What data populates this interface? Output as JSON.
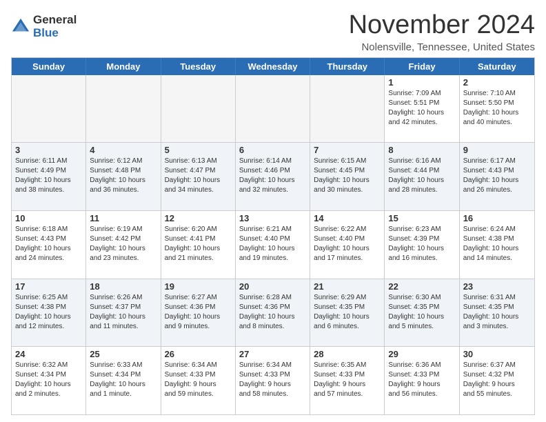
{
  "logo": {
    "general": "General",
    "blue": "Blue"
  },
  "title": "November 2024",
  "location": "Nolensville, Tennessee, United States",
  "weekdays": [
    "Sunday",
    "Monday",
    "Tuesday",
    "Wednesday",
    "Thursday",
    "Friday",
    "Saturday"
  ],
  "weeks": [
    [
      {
        "day": "",
        "info": "",
        "empty": true
      },
      {
        "day": "",
        "info": "",
        "empty": true
      },
      {
        "day": "",
        "info": "",
        "empty": true
      },
      {
        "day": "",
        "info": "",
        "empty": true
      },
      {
        "day": "",
        "info": "",
        "empty": true
      },
      {
        "day": "1",
        "info": "Sunrise: 7:09 AM\nSunset: 5:51 PM\nDaylight: 10 hours\nand 42 minutes.",
        "empty": false
      },
      {
        "day": "2",
        "info": "Sunrise: 7:10 AM\nSunset: 5:50 PM\nDaylight: 10 hours\nand 40 minutes.",
        "empty": false
      }
    ],
    [
      {
        "day": "3",
        "info": "Sunrise: 6:11 AM\nSunset: 4:49 PM\nDaylight: 10 hours\nand 38 minutes.",
        "empty": false
      },
      {
        "day": "4",
        "info": "Sunrise: 6:12 AM\nSunset: 4:48 PM\nDaylight: 10 hours\nand 36 minutes.",
        "empty": false
      },
      {
        "day": "5",
        "info": "Sunrise: 6:13 AM\nSunset: 4:47 PM\nDaylight: 10 hours\nand 34 minutes.",
        "empty": false
      },
      {
        "day": "6",
        "info": "Sunrise: 6:14 AM\nSunset: 4:46 PM\nDaylight: 10 hours\nand 32 minutes.",
        "empty": false
      },
      {
        "day": "7",
        "info": "Sunrise: 6:15 AM\nSunset: 4:45 PM\nDaylight: 10 hours\nand 30 minutes.",
        "empty": false
      },
      {
        "day": "8",
        "info": "Sunrise: 6:16 AM\nSunset: 4:44 PM\nDaylight: 10 hours\nand 28 minutes.",
        "empty": false
      },
      {
        "day": "9",
        "info": "Sunrise: 6:17 AM\nSunset: 4:43 PM\nDaylight: 10 hours\nand 26 minutes.",
        "empty": false
      }
    ],
    [
      {
        "day": "10",
        "info": "Sunrise: 6:18 AM\nSunset: 4:43 PM\nDaylight: 10 hours\nand 24 minutes.",
        "empty": false
      },
      {
        "day": "11",
        "info": "Sunrise: 6:19 AM\nSunset: 4:42 PM\nDaylight: 10 hours\nand 23 minutes.",
        "empty": false
      },
      {
        "day": "12",
        "info": "Sunrise: 6:20 AM\nSunset: 4:41 PM\nDaylight: 10 hours\nand 21 minutes.",
        "empty": false
      },
      {
        "day": "13",
        "info": "Sunrise: 6:21 AM\nSunset: 4:40 PM\nDaylight: 10 hours\nand 19 minutes.",
        "empty": false
      },
      {
        "day": "14",
        "info": "Sunrise: 6:22 AM\nSunset: 4:40 PM\nDaylight: 10 hours\nand 17 minutes.",
        "empty": false
      },
      {
        "day": "15",
        "info": "Sunrise: 6:23 AM\nSunset: 4:39 PM\nDaylight: 10 hours\nand 16 minutes.",
        "empty": false
      },
      {
        "day": "16",
        "info": "Sunrise: 6:24 AM\nSunset: 4:38 PM\nDaylight: 10 hours\nand 14 minutes.",
        "empty": false
      }
    ],
    [
      {
        "day": "17",
        "info": "Sunrise: 6:25 AM\nSunset: 4:38 PM\nDaylight: 10 hours\nand 12 minutes.",
        "empty": false
      },
      {
        "day": "18",
        "info": "Sunrise: 6:26 AM\nSunset: 4:37 PM\nDaylight: 10 hours\nand 11 minutes.",
        "empty": false
      },
      {
        "day": "19",
        "info": "Sunrise: 6:27 AM\nSunset: 4:36 PM\nDaylight: 10 hours\nand 9 minutes.",
        "empty": false
      },
      {
        "day": "20",
        "info": "Sunrise: 6:28 AM\nSunset: 4:36 PM\nDaylight: 10 hours\nand 8 minutes.",
        "empty": false
      },
      {
        "day": "21",
        "info": "Sunrise: 6:29 AM\nSunset: 4:35 PM\nDaylight: 10 hours\nand 6 minutes.",
        "empty": false
      },
      {
        "day": "22",
        "info": "Sunrise: 6:30 AM\nSunset: 4:35 PM\nDaylight: 10 hours\nand 5 minutes.",
        "empty": false
      },
      {
        "day": "23",
        "info": "Sunrise: 6:31 AM\nSunset: 4:35 PM\nDaylight: 10 hours\nand 3 minutes.",
        "empty": false
      }
    ],
    [
      {
        "day": "24",
        "info": "Sunrise: 6:32 AM\nSunset: 4:34 PM\nDaylight: 10 hours\nand 2 minutes.",
        "empty": false
      },
      {
        "day": "25",
        "info": "Sunrise: 6:33 AM\nSunset: 4:34 PM\nDaylight: 10 hours\nand 1 minute.",
        "empty": false
      },
      {
        "day": "26",
        "info": "Sunrise: 6:34 AM\nSunset: 4:33 PM\nDaylight: 9 hours\nand 59 minutes.",
        "empty": false
      },
      {
        "day": "27",
        "info": "Sunrise: 6:34 AM\nSunset: 4:33 PM\nDaylight: 9 hours\nand 58 minutes.",
        "empty": false
      },
      {
        "day": "28",
        "info": "Sunrise: 6:35 AM\nSunset: 4:33 PM\nDaylight: 9 hours\nand 57 minutes.",
        "empty": false
      },
      {
        "day": "29",
        "info": "Sunrise: 6:36 AM\nSunset: 4:33 PM\nDaylight: 9 hours\nand 56 minutes.",
        "empty": false
      },
      {
        "day": "30",
        "info": "Sunrise: 6:37 AM\nSunset: 4:32 PM\nDaylight: 9 hours\nand 55 minutes.",
        "empty": false
      }
    ]
  ]
}
